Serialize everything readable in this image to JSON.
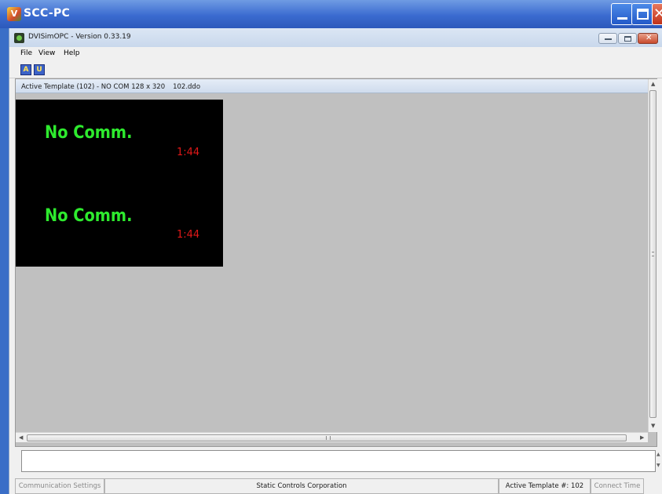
{
  "outer_window": {
    "logo_text": "V",
    "title": "SCC-PC"
  },
  "app_window": {
    "title": "DVISimOPC - Version 0.33.19"
  },
  "menu": {
    "items": [
      "File",
      "View",
      "Help"
    ]
  },
  "toolbar": {
    "buttons": [
      {
        "label": "A"
      },
      {
        "label": "U"
      }
    ]
  },
  "document": {
    "title_template": "Active Template (102) - NO COM 128 x 320",
    "title_file": "102.ddo",
    "display": {
      "line1_text": "No Comm.",
      "line1_time": "1:44",
      "line2_text": "No Comm.",
      "line2_time": "1:44",
      "colors": {
        "text": "#2eea2e",
        "time": "#e01818",
        "background": "#000000"
      }
    }
  },
  "message_box": {
    "value": ""
  },
  "status_bar": {
    "communication_settings": "Communication Settings",
    "company": "Static Controls Corporation",
    "active_template": "Active Template #: 102",
    "connect_time": "Connect Time"
  }
}
